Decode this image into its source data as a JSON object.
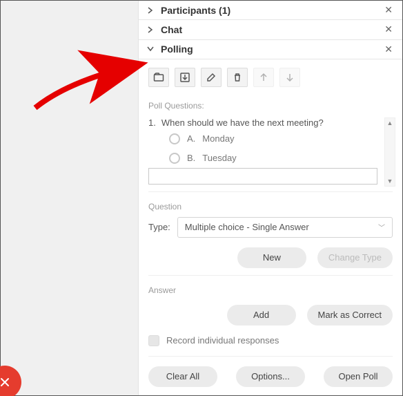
{
  "sections": {
    "participants": {
      "title": "Participants (1)"
    },
    "chat": {
      "title": "Chat"
    },
    "polling": {
      "title": "Polling"
    }
  },
  "toolbar": {
    "open": "open-icon",
    "save": "save-icon",
    "edit": "edit-icon",
    "delete": "delete-icon",
    "moveUp": "arrow-up-icon",
    "moveDown": "arrow-down-icon"
  },
  "poll": {
    "label": "Poll Questions:",
    "number": "1.",
    "question": "When should we have the next meeting?",
    "answers": [
      {
        "letter": "A.",
        "text": "Monday"
      },
      {
        "letter": "B.",
        "text": "Tuesday"
      }
    ],
    "newAnswer": ""
  },
  "questionPanel": {
    "label": "Question",
    "typeLabel": "Type:",
    "typeValue": "Multiple choice - Single Answer",
    "newBtn": "New",
    "changeBtn": "Change Type"
  },
  "answerPanel": {
    "label": "Answer",
    "addBtn": "Add",
    "markBtn": "Mark as Correct",
    "recordLabel": "Record individual responses"
  },
  "footer": {
    "clear": "Clear All",
    "options": "Options...",
    "open": "Open Poll"
  }
}
